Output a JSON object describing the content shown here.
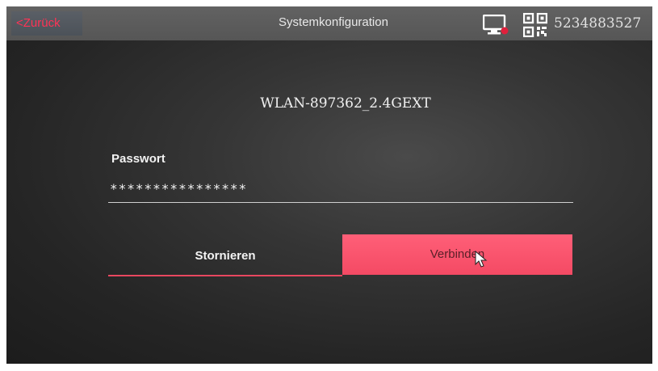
{
  "header": {
    "back_label": "<Zurück",
    "title": "Systemkonfiguration",
    "device_id": "5234883527",
    "icons": [
      "monitor-icon",
      "qr-code-icon"
    ]
  },
  "wifi": {
    "ssid": "WLAN-897362_2.4GEXT",
    "password_label": "Passwort",
    "password_value": "****************"
  },
  "actions": {
    "cancel_label": "Stornieren",
    "connect_label": "Verbinden"
  },
  "colors": {
    "accent": "#f44a64",
    "back_text": "#ff3355"
  }
}
